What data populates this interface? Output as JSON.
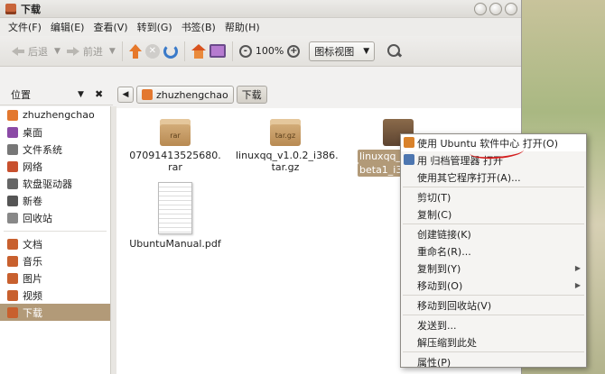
{
  "window": {
    "title": "下载"
  },
  "menu": [
    "文件(F)",
    "编辑(E)",
    "查看(V)",
    "转到(G)",
    "书签(B)",
    "帮助(H)"
  ],
  "toolbar": {
    "back": "后退",
    "forward": "前进",
    "zoom": "100%",
    "view_mode": "图标视图"
  },
  "sidebar": {
    "header": "位置",
    "items": [
      {
        "label": "zhuzhengchao",
        "icon": "home-folder-icon",
        "color": "#e3782f"
      },
      {
        "label": "桌面",
        "icon": "desktop-icon",
        "color": "#8b4aa6"
      },
      {
        "label": "文件系统",
        "icon": "filesystem-icon",
        "color": "#777777"
      },
      {
        "label": "网络",
        "icon": "network-icon",
        "color": "#c8502e"
      },
      {
        "label": "软盘驱动器",
        "icon": "floppy-icon",
        "color": "#666666"
      },
      {
        "label": "新卷",
        "icon": "volume-icon",
        "color": "#555555"
      },
      {
        "label": "回收站",
        "icon": "trash-icon",
        "color": "#888888"
      }
    ],
    "bookmarks": [
      {
        "label": "文档",
        "icon": "documents-folder-icon",
        "color": "#c8602e"
      },
      {
        "label": "音乐",
        "icon": "music-folder-icon",
        "color": "#c8602e"
      },
      {
        "label": "图片",
        "icon": "pictures-folder-icon",
        "color": "#c8602e"
      },
      {
        "label": "视频",
        "icon": "videos-folder-icon",
        "color": "#c8602e"
      },
      {
        "label": "下载",
        "icon": "downloads-folder-icon",
        "color": "#c8602e",
        "selected": true
      }
    ]
  },
  "pathbar": {
    "home": "zhuzhengchao",
    "current": "下载"
  },
  "files": [
    {
      "name": "07091413525680.\nrar",
      "line1": "07091413525680.",
      "line2": "rar",
      "type_label": "rar"
    },
    {
      "name": "linuxqq_v1.0.2_i386.tar.gz",
      "line1": "linuxqq_v1.0.2_i386.",
      "line2": "tar.gz",
      "type_label": "tar.gz"
    },
    {
      "line1": "linuxqq_",
      "line2": "beta1_i3",
      "type_label": "deb"
    },
    {
      "line1": "UbuntuManual.pdf"
    }
  ],
  "context_menu": [
    "使用 Ubuntu 软件中心 打开(O)",
    "用 归档管理器 打开",
    "使用其它程序打开(A)...",
    "剪切(T)",
    "复制(C)",
    "创建链接(K)",
    "重命名(R)...",
    "复制到(Y)",
    "移动到(O)",
    "移动到回收站(V)",
    "发送到...",
    "解压缩到此处",
    "属性(P)"
  ]
}
